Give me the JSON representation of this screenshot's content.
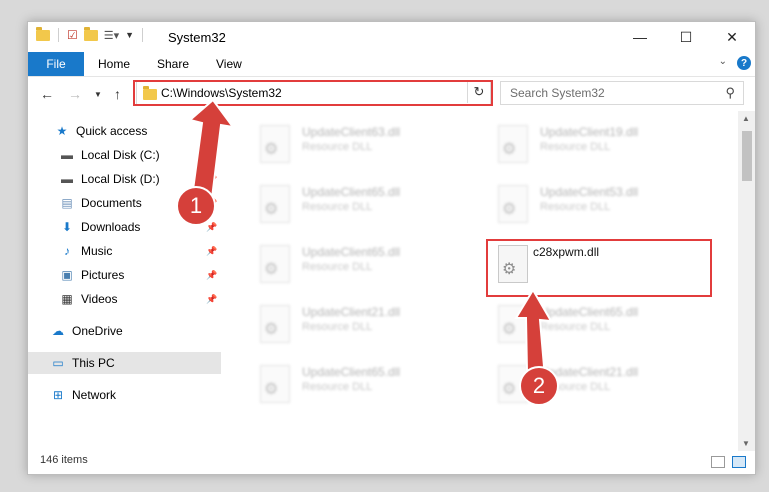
{
  "window": {
    "title": "System32",
    "minimize": "—",
    "maximize": "☐",
    "close": "✕"
  },
  "ribbon": {
    "file": "File",
    "tabs": [
      "Home",
      "Share",
      "View"
    ],
    "help": "?"
  },
  "address": {
    "path": "C:\\Windows\\System32"
  },
  "search": {
    "placeholder": "Search System32"
  },
  "sidebar": {
    "items": [
      {
        "label": "Quick access",
        "icon": "star-icon"
      },
      {
        "label": "Local Disk (C:)",
        "icon": "drive-icon"
      },
      {
        "label": "Local Disk (D:)",
        "icon": "drive-icon"
      },
      {
        "label": "Documents",
        "icon": "documents-icon"
      },
      {
        "label": "Downloads",
        "icon": "download-icon"
      },
      {
        "label": "Music",
        "icon": "music-icon"
      },
      {
        "label": "Pictures",
        "icon": "pictures-icon"
      },
      {
        "label": "Videos",
        "icon": "videos-icon"
      },
      {
        "label": "OneDrive",
        "icon": "cloud-icon"
      },
      {
        "label": "This PC",
        "icon": "computer-icon"
      },
      {
        "label": "Network",
        "icon": "network-icon"
      }
    ]
  },
  "files": {
    "left": [
      {
        "name": "UpdateClient63.dll",
        "type": "Resource DLL"
      },
      {
        "name": "UpdateClient65.dll",
        "type": "Resource DLL"
      },
      {
        "name": "UpdateClient65.dll",
        "type": "Resource DLL"
      },
      {
        "name": "UpdateClient21.dll",
        "type": "Resource DLL"
      },
      {
        "name": "UpdateClient65.dll",
        "type": "Resource DLL"
      }
    ],
    "right": [
      {
        "name": "UpdateClient19.dll",
        "type": "Resource DLL"
      },
      {
        "name": "UpdateClient53.dll",
        "type": "Resource DLL"
      },
      {
        "name": "c28xpwm.dll",
        "type": ""
      },
      {
        "name": "UpdateClient65.dll",
        "type": "Resource DLL"
      },
      {
        "name": "UpdateClient21.dll",
        "type": "Resource DLL"
      }
    ]
  },
  "status": {
    "count": "146 items"
  },
  "annotations": {
    "step1": "1",
    "step2": "2",
    "color": "#d5403a"
  }
}
